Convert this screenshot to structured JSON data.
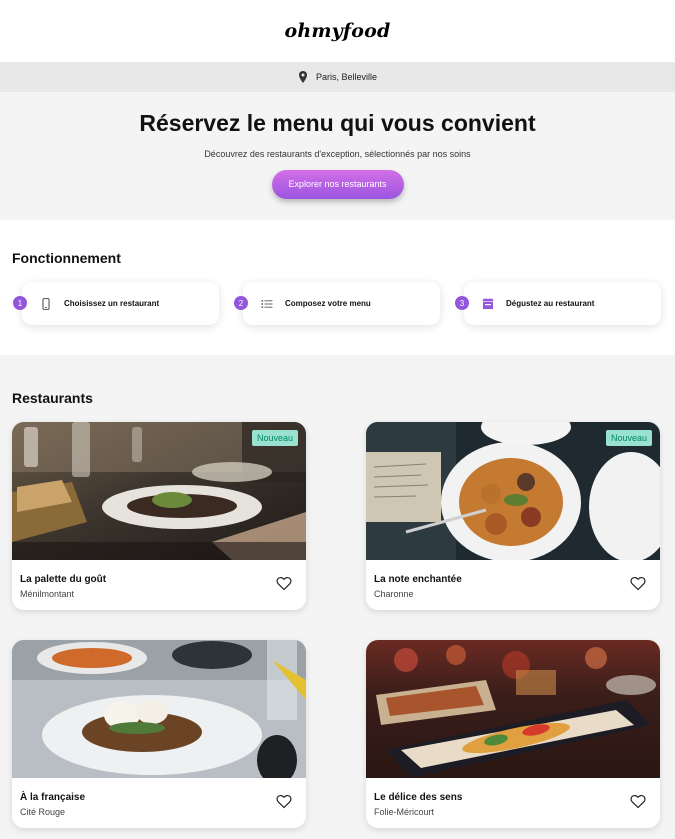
{
  "header": {
    "logo": "ohmyfood"
  },
  "location": {
    "text": "Paris, Belleville",
    "icon": "location-pin-icon"
  },
  "hero": {
    "title": "Réservez le menu qui vous convient",
    "subtitle": "Découvrez des restaurants d'exception, sélectionnés par nos soins",
    "cta_label": "Explorer nos restaurants"
  },
  "how": {
    "title": "Fonctionnement",
    "steps": [
      {
        "number": "1",
        "label": "Choisissez un restaurant",
        "icon": "mobile-phone-icon"
      },
      {
        "number": "2",
        "label": "Composez votre menu",
        "icon": "list-icon"
      },
      {
        "number": "3",
        "label": "Dégustez au restaurant",
        "icon": "store-icon"
      }
    ]
  },
  "restaurants": {
    "title": "Restaurants",
    "items": [
      {
        "name": "La palette du goût",
        "area": "Ménilmontant",
        "badge": "Nouveau"
      },
      {
        "name": "La note enchantée",
        "area": "Charonne",
        "badge": "Nouveau"
      },
      {
        "name": "À la française",
        "area": "Cité Rouge"
      },
      {
        "name": "Le délice des sens",
        "area": "Folie-Méricourt"
      }
    ]
  },
  "colors": {
    "accent_start": "#d36fe6",
    "accent_end": "#9a55e0",
    "badge_bg": "#99e2d0",
    "badge_text": "#008766"
  }
}
